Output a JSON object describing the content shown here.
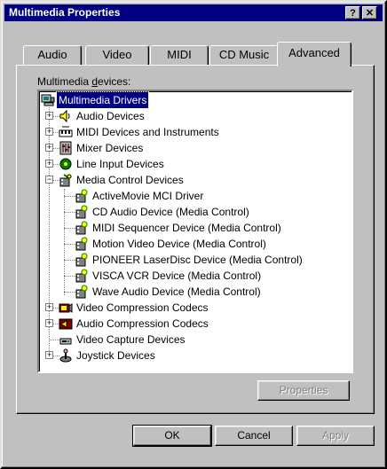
{
  "window": {
    "title": "Multimedia Properties",
    "help_button": "?",
    "close_button": "✕"
  },
  "tabs": [
    {
      "label": "Audio",
      "active": false
    },
    {
      "label": "Video",
      "active": false
    },
    {
      "label": "MIDI",
      "active": false
    },
    {
      "label": "CD Music",
      "active": false
    },
    {
      "label": "Advanced",
      "active": true
    }
  ],
  "devices_label_prefix": "Multimedia ",
  "devices_label_accel": "d",
  "devices_label_suffix": "evices:",
  "tree": {
    "root": "Multimedia Drivers",
    "categories": [
      {
        "label": "Audio Devices",
        "expanded": false,
        "icon": "speaker-icon"
      },
      {
        "label": "MIDI Devices and Instruments",
        "expanded": false,
        "icon": "midi-icon"
      },
      {
        "label": "Mixer Devices",
        "expanded": false,
        "icon": "mixer-icon"
      },
      {
        "label": "Line Input Devices",
        "expanded": false,
        "icon": "line-input-icon"
      },
      {
        "label": "Media Control Devices",
        "expanded": true,
        "icon": "media-control-icon"
      }
    ],
    "media_control_children": [
      "ActiveMovie MCI Driver",
      "CD Audio Device (Media Control)",
      "MIDI Sequencer Device (Media Control)",
      "Motion Video Device (Media Control)",
      "PIONEER LaserDisc Device (Media Control)",
      "VISCA VCR Device (Media Control)",
      "Wave Audio Device (Media Control)"
    ],
    "more_categories": [
      {
        "label": "Video Compression Codecs",
        "expanded": false,
        "icon": "video-codec-icon"
      },
      {
        "label": "Audio Compression Codecs",
        "expanded": false,
        "icon": "audio-codec-icon"
      },
      {
        "label": "Video Capture Devices",
        "expanded": null,
        "icon": "video-capture-icon"
      },
      {
        "label": "Joystick Devices",
        "expanded": false,
        "icon": "joystick-icon"
      }
    ]
  },
  "buttons": {
    "properties": "Properties",
    "ok": "OK",
    "cancel": "Cancel",
    "apply": "Apply"
  },
  "colors": {
    "desktop": "#008080",
    "face": "#c0c0c0",
    "title": "#000080",
    "selection": "#000080"
  }
}
